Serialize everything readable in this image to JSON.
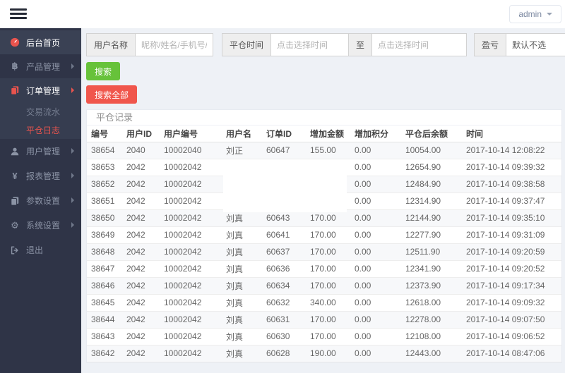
{
  "topbar": {
    "user_menu": "admin"
  },
  "sidebar": {
    "items": [
      {
        "label": "后台首页",
        "icon": "dashboard-icon"
      },
      {
        "label": "产品管理",
        "icon": "product-icon"
      },
      {
        "label": "订单管理",
        "icon": "order-icon"
      },
      {
        "label": "交易流水"
      },
      {
        "label": "平仓日志"
      },
      {
        "label": "用户管理",
        "icon": "user-icon"
      },
      {
        "label": "报表管理",
        "icon": "report-icon"
      },
      {
        "label": "参数设置",
        "icon": "params-icon"
      },
      {
        "label": "系统设置",
        "icon": "system-icon"
      },
      {
        "label": "退出",
        "icon": "logout-icon"
      }
    ]
  },
  "filters": {
    "username_label": "用户名称",
    "username_placeholder": "昵称/姓名/手机号/编号",
    "time_label": "平仓时间",
    "time_from_placeholder": "点击选择时间",
    "to_label": "至",
    "time_to_placeholder": "点击选择时间",
    "profit_label": "盈亏",
    "profit_value": "默认不选"
  },
  "buttons": {
    "search": "搜索",
    "search_all": "搜索全部"
  },
  "panel": {
    "title": "平仓记录",
    "columns": [
      "编号",
      "用户ID",
      "用户编号",
      "用户名",
      "订单ID",
      "增加金额",
      "增加积分",
      "平仓后余额",
      "时间"
    ],
    "rows": [
      [
        "38654",
        "2040",
        "10002040",
        "刘正",
        "60647",
        "155.00",
        "0.00",
        "10054.00",
        "2017-10-14 12:08:22"
      ],
      [
        "38653",
        "2042",
        "10002042",
        "",
        "",
        "",
        "0.00",
        "12654.90",
        "2017-10-14 09:39:32"
      ],
      [
        "38652",
        "2042",
        "10002042",
        "",
        "",
        "",
        "0.00",
        "12484.90",
        "2017-10-14 09:38:58"
      ],
      [
        "38651",
        "2042",
        "10002042",
        "",
        "",
        "",
        "0.00",
        "12314.90",
        "2017-10-14 09:37:47"
      ],
      [
        "38650",
        "2042",
        "10002042",
        "刘真",
        "60643",
        "170.00",
        "0.00",
        "12144.90",
        "2017-10-14 09:35:10"
      ],
      [
        "38649",
        "2042",
        "10002042",
        "刘真",
        "60641",
        "170.00",
        "0.00",
        "12277.90",
        "2017-10-14 09:31:09"
      ],
      [
        "38648",
        "2042",
        "10002042",
        "刘真",
        "60637",
        "170.00",
        "0.00",
        "12511.90",
        "2017-10-14 09:20:59"
      ],
      [
        "38647",
        "2042",
        "10002042",
        "刘真",
        "60636",
        "170.00",
        "0.00",
        "12341.90",
        "2017-10-14 09:20:52"
      ],
      [
        "38646",
        "2042",
        "10002042",
        "刘真",
        "60634",
        "170.00",
        "0.00",
        "12373.90",
        "2017-10-14 09:17:34"
      ],
      [
        "38645",
        "2042",
        "10002042",
        "刘真",
        "60632",
        "340.00",
        "0.00",
        "12618.00",
        "2017-10-14 09:09:32"
      ],
      [
        "38644",
        "2042",
        "10002042",
        "刘真",
        "60631",
        "170.00",
        "0.00",
        "12278.00",
        "2017-10-14 09:07:50"
      ],
      [
        "38643",
        "2042",
        "10002042",
        "刘真",
        "60630",
        "170.00",
        "0.00",
        "12108.00",
        "2017-10-14 09:06:52"
      ],
      [
        "38642",
        "2042",
        "10002042",
        "刘真",
        "60628",
        "190.00",
        "0.00",
        "12443.00",
        "2017-10-14 08:47:06"
      ]
    ]
  },
  "colors": {
    "accent_red": "#e8544e",
    "button_green": "#67c23a",
    "button_red": "#f0564c",
    "sidebar_bg": "#2f3447"
  }
}
